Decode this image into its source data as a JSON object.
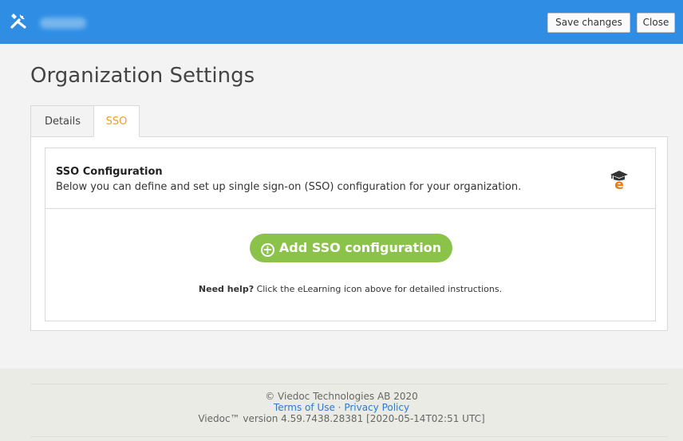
{
  "topbar": {
    "save_label": "Save changes",
    "close_label": "Close",
    "colors": {
      "background": "#2f8ee4"
    }
  },
  "page": {
    "title": "Organization Settings"
  },
  "tabs": [
    {
      "label": "Details",
      "active": false
    },
    {
      "label": "SSO",
      "active": true
    }
  ],
  "sso": {
    "title": "SSO Configuration",
    "description": "Below you can define and set up single sign-on (SSO) configuration for your organization.",
    "add_button_label": "Add SSO configuration",
    "help_bold": "Need help?",
    "help_text": " Click the eLearning icon above for detailed instructions.",
    "accent_color": "#8bc34a"
  },
  "footer": {
    "copyright": "© Viedoc Technologies AB 2020",
    "terms": "Terms of Use",
    "separator": " · ",
    "privacy": "Privacy Policy",
    "version": "Viedoc™ version 4.59.7438.28381 [2020-05-14T02:51 UTC]"
  }
}
